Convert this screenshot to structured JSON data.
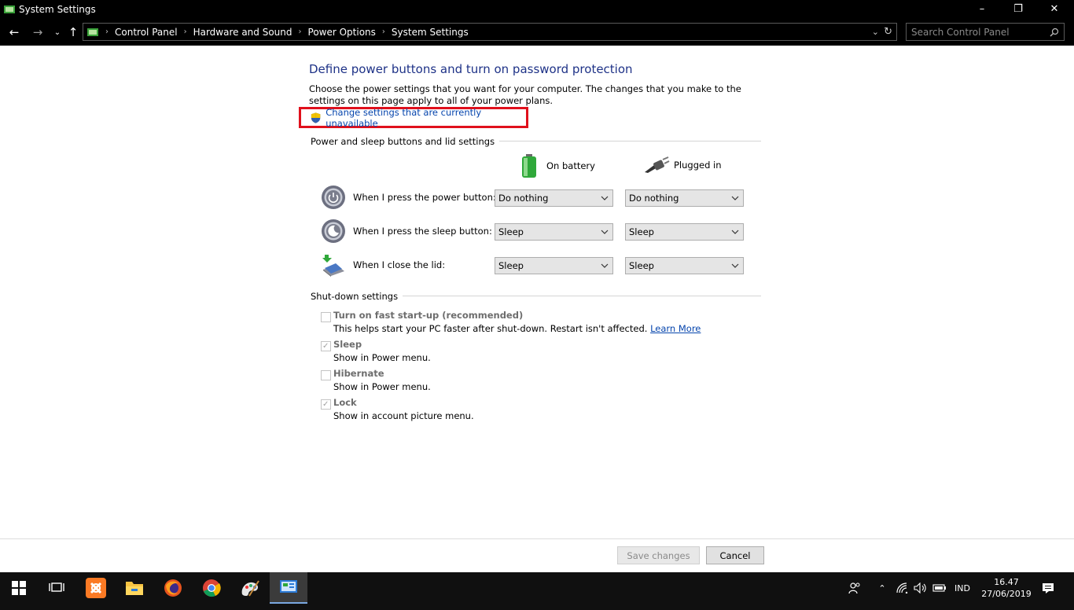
{
  "window": {
    "title": "System Settings",
    "icon": "control-panel-icon"
  },
  "address": {
    "crumbs": [
      "Control Panel",
      "Hardware and Sound",
      "Power Options",
      "System Settings"
    ],
    "search_placeholder": "Search Control Panel"
  },
  "page": {
    "heading": "Define power buttons and turn on password protection",
    "description": "Choose the power settings that you want for your computer. The changes that you make to the settings on this page apply to all of your power plans.",
    "change_settings_link": "Change settings that are currently unavailable",
    "highlight_color": "#e0101c"
  },
  "power_section": {
    "label": "Power and sleep buttons and lid settings",
    "columns": [
      "On battery",
      "Plugged in"
    ],
    "rows": [
      {
        "label": "When I press the power button:",
        "icon": "power-button-icon",
        "battery": "Do nothing",
        "plugged": "Do nothing"
      },
      {
        "label": "When I press the sleep button:",
        "icon": "sleep-button-icon",
        "battery": "Sleep",
        "plugged": "Sleep"
      },
      {
        "label": "When I close the lid:",
        "icon": "laptop-lid-icon",
        "battery": "Sleep",
        "plugged": "Sleep"
      }
    ]
  },
  "shutdown_section": {
    "label": "Shut-down settings",
    "items": [
      {
        "title": "Turn on fast start-up (recommended)",
        "subtitle": "This helps start your PC faster after shut-down. Restart isn't affected.",
        "link": "Learn More",
        "checked": false
      },
      {
        "title": "Sleep",
        "subtitle": "Show in Power menu.",
        "checked": true
      },
      {
        "title": "Hibernate",
        "subtitle": "Show in Power menu.",
        "checked": false
      },
      {
        "title": "Lock",
        "subtitle": "Show in account picture menu.",
        "checked": true
      }
    ]
  },
  "buttons": {
    "save": "Save changes",
    "cancel": "Cancel"
  },
  "taskbar": {
    "apps": [
      "start-icon",
      "task-view-icon",
      "xampp-icon",
      "file-explorer-icon",
      "firefox-icon",
      "chrome-icon",
      "paint-icon",
      "control-panel-icon"
    ],
    "language": "IND",
    "time": "16.47",
    "date": "27/06/2019"
  }
}
